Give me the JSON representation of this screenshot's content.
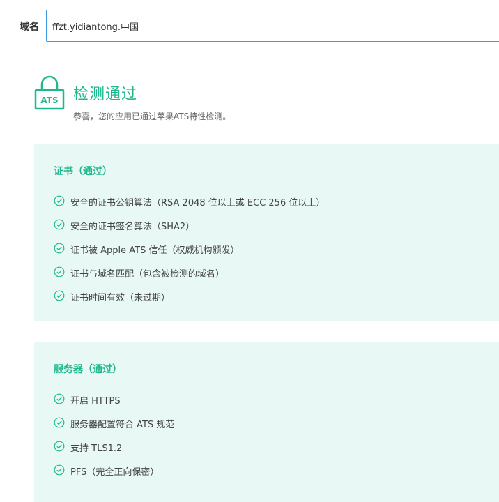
{
  "domain_form": {
    "label": "域名",
    "value": "ffzt.yidiantong.中国"
  },
  "result": {
    "icon_text": "ATS",
    "title": "检测通过",
    "subtitle": "恭喜，您的应用已通过苹果ATS特性检测。"
  },
  "sections": [
    {
      "title": "证书（通过）",
      "items": [
        "安全的证书公钥算法（RSA 2048 位以上或 ECC 256 位以上）",
        "安全的证书签名算法（SHA2）",
        "证书被 Apple ATS 信任（权威机构颁发）",
        "证书与域名匹配（包含被检测的域名）",
        "证书时间有效（未过期）"
      ]
    },
    {
      "title": "服务器（通过）",
      "items": [
        "开启 HTTPS",
        "服务器配置符合 ATS 规范",
        "支持 TLS1.2",
        "PFS（完全正向保密）"
      ]
    }
  ],
  "colors": {
    "accent": "#1fb88e",
    "section_bg": "#e8f8f4",
    "input_border": "#3a9bdc"
  },
  "icons": {
    "result": "lock-ats-icon",
    "item": "check-circle-icon"
  }
}
